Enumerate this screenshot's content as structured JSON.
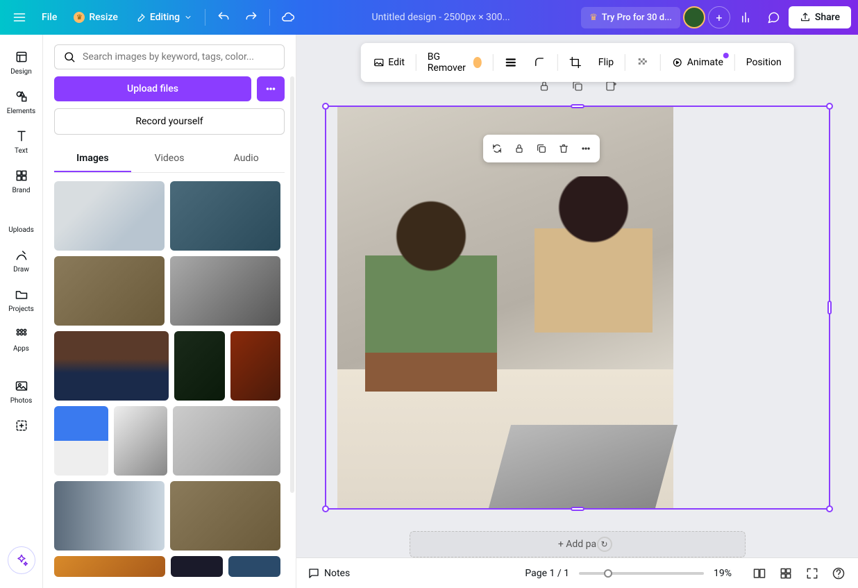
{
  "header": {
    "file": "File",
    "resize": "Resize",
    "editing": "Editing",
    "title": "Untitled design - 2500px × 300...",
    "try_pro": "Try Pro for 30 d...",
    "share": "Share"
  },
  "rail": {
    "design": "Design",
    "elements": "Elements",
    "text": "Text",
    "brand": "Brand",
    "uploads": "Uploads",
    "draw": "Draw",
    "projects": "Projects",
    "apps": "Apps",
    "photos": "Photos"
  },
  "panel": {
    "search_placeholder": "Search images by keyword, tags, color...",
    "upload": "Upload files",
    "record": "Record yourself",
    "tabs": {
      "images": "Images",
      "videos": "Videos",
      "audio": "Audio"
    }
  },
  "toolbar": {
    "edit": "Edit",
    "bg_remover": "BG Remover",
    "flip": "Flip",
    "animate": "Animate",
    "position": "Position"
  },
  "canvas": {
    "add_page": "+ Add pa"
  },
  "bottom": {
    "notes": "Notes",
    "page": "Page 1 / 1",
    "zoom": "19%"
  }
}
